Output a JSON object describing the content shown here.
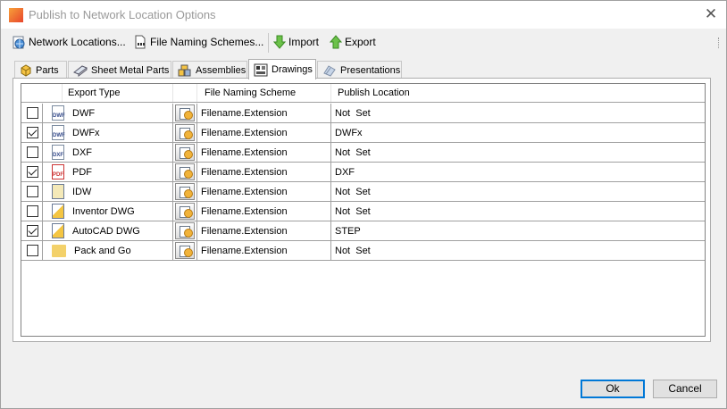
{
  "window": {
    "title": "Publish to Network Location Options",
    "close_glyph": "✕"
  },
  "toolbar": {
    "network_locations": "Network Locations...",
    "file_naming_schemes": "File Naming Schemes...",
    "import": "Import",
    "export": "Export"
  },
  "tabs": [
    {
      "label": "Parts",
      "icon": "part-cube-icon"
    },
    {
      "label": "Sheet Metal Parts",
      "icon": "sheet-metal-icon"
    },
    {
      "label": "Assemblies",
      "icon": "assembly-icon"
    },
    {
      "label": "Drawings",
      "icon": "drawing-icon",
      "active": true
    },
    {
      "label": "Presentations",
      "icon": "presentation-icon"
    }
  ],
  "table": {
    "columns": [
      "Export Type",
      "File Naming Scheme",
      "Publish Location"
    ],
    "rows": [
      {
        "checked": false,
        "icon": "dwf-file-icon",
        "icon_text": "DWF",
        "type": "DWF",
        "scheme": "Filename.Extension",
        "location": "Not  Set"
      },
      {
        "checked": true,
        "icon": "dwfx-file-icon",
        "icon_text": "DWF",
        "type": "DWFx",
        "scheme": "Filename.Extension",
        "location": "DWFx"
      },
      {
        "checked": false,
        "icon": "dxf-file-icon",
        "icon_text": "DXF",
        "type": "DXF",
        "scheme": "Filename.Extension",
        "location": "Not  Set"
      },
      {
        "checked": true,
        "icon": "pdf-file-icon",
        "icon_text": "PDF",
        "type": "PDF",
        "scheme": "Filename.Extension",
        "location": "DXF"
      },
      {
        "checked": false,
        "icon": "idw-file-icon",
        "icon_text": "",
        "type": "IDW",
        "scheme": "Filename.Extension",
        "location": "Not  Set"
      },
      {
        "checked": false,
        "icon": "inventor-dwg-file-icon",
        "icon_text": "",
        "type": "Inventor DWG",
        "scheme": "Filename.Extension",
        "location": "Not  Set"
      },
      {
        "checked": true,
        "icon": "autocad-dwg-file-icon",
        "icon_text": "",
        "type": "AutoCAD DWG",
        "scheme": "Filename.Extension",
        "location": "STEP"
      },
      {
        "checked": false,
        "icon": "pack-and-go-icon",
        "icon_text": "",
        "type": "Pack and Go",
        "scheme": "Filename.Extension",
        "location": "Not  Set"
      }
    ]
  },
  "buttons": {
    "ok": "Ok",
    "cancel": "Cancel"
  }
}
